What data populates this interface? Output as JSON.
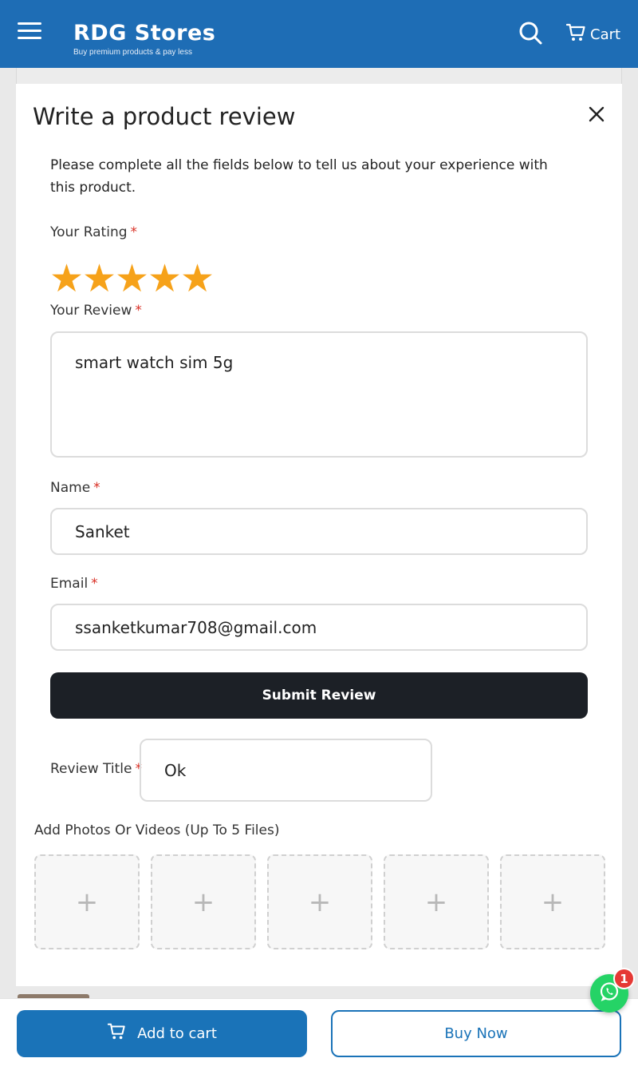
{
  "header": {
    "brand_title": "RDG Stores",
    "brand_tagline": "Buy premium products & pay less",
    "cart_label": "Cart",
    "background_color": "#1e6db5"
  },
  "modal": {
    "title": "Write a product review",
    "intro": "Please complete all the fields below to tell us about your experience with this product.",
    "rating": {
      "label": "Your Rating",
      "required_mark": "*",
      "value": 5,
      "max": 5,
      "star_color": "#f6a21a"
    },
    "review": {
      "label": "Your Review",
      "required_mark": "*",
      "value": "smart watch sim 5g"
    },
    "name": {
      "label": "Name",
      "required_mark": "*",
      "value": "Sanket"
    },
    "email": {
      "label": "Email",
      "required_mark": "*",
      "value": "ssanketkumar708@gmail.com"
    },
    "submit_label": "Submit Review",
    "review_title": {
      "label": "Review Title",
      "required_mark": "*",
      "value": "Ok"
    },
    "upload": {
      "label": "Add Photos Or Videos (Up To 5 Files)",
      "slots": [
        "+",
        "+",
        "+",
        "+",
        "+"
      ]
    }
  },
  "bottom_bar": {
    "add_to_cart_label": "Add to cart",
    "buy_now_label": "Buy Now",
    "accent_color": "#1a73b8"
  },
  "whatsapp": {
    "badge_count": "1"
  }
}
